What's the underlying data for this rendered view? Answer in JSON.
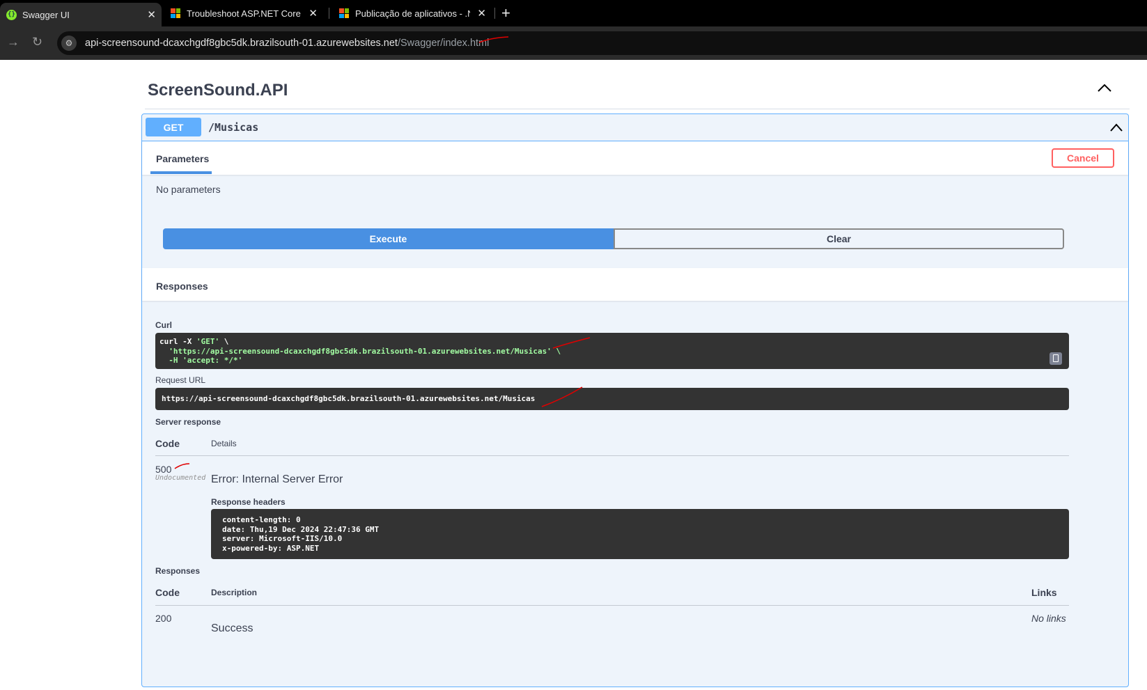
{
  "browser": {
    "tabs": [
      {
        "title": "Swagger UI",
        "active": true,
        "icon": "swagger-icon"
      },
      {
        "title": "Troubleshoot ASP.NET Core on",
        "active": false,
        "icon": "microsoft-icon"
      },
      {
        "title": "Publicação de aplicativos - .NET",
        "active": false,
        "icon": "microsoft-icon"
      }
    ],
    "close_glyph": "✕",
    "new_tab_glyph": "+",
    "url_host": "api-screensound-dcaxchgdf8gbc5dk.brazilsouth-01.azurewebsites.net",
    "url_path": "/Swagger/index.html"
  },
  "api": {
    "title": "ScreenSound.API"
  },
  "operation": {
    "method": "GET",
    "path": "/Musicas",
    "parameters_tab": "Parameters",
    "cancel_label": "Cancel",
    "no_parameters": "No parameters",
    "execute_label": "Execute",
    "clear_label": "Clear",
    "responses_heading": "Responses",
    "curl_label": "Curl",
    "curl_lines": [
      "curl -X 'GET' \\",
      "  'https://api-screensound-dcaxchgdf8gbc5dk.brazilsouth-01.azurewebsites.net/Musicas' \\",
      "  -H 'accept: */*'"
    ],
    "request_url_label": "Request URL",
    "request_url": "https://api-screensound-dcaxchgdf8gbc5dk.brazilsouth-01.azurewebsites.net/Musicas",
    "server_response_label": "Server response",
    "code_header": "Code",
    "details_header": "Details",
    "server_code": "500",
    "undocumented": "Undocumented",
    "error_text": "Error: Internal Server Error",
    "response_headers_label": "Response headers",
    "response_headers": [
      "content-length: 0",
      "date: Thu,19 Dec 2024 22:47:36 GMT",
      "server: Microsoft-IIS/10.0",
      "x-powered-by: ASP.NET"
    ],
    "responses_label": "Responses",
    "description_header": "Description",
    "links_header": "Links",
    "doc_code": "200",
    "doc_description": "Success",
    "doc_links": "No links"
  },
  "colors": {
    "get_method": "#61affe",
    "execute": "#4990e2",
    "cancel": "#ff6060",
    "code_bg": "#333333",
    "annotation": "#e00000"
  }
}
